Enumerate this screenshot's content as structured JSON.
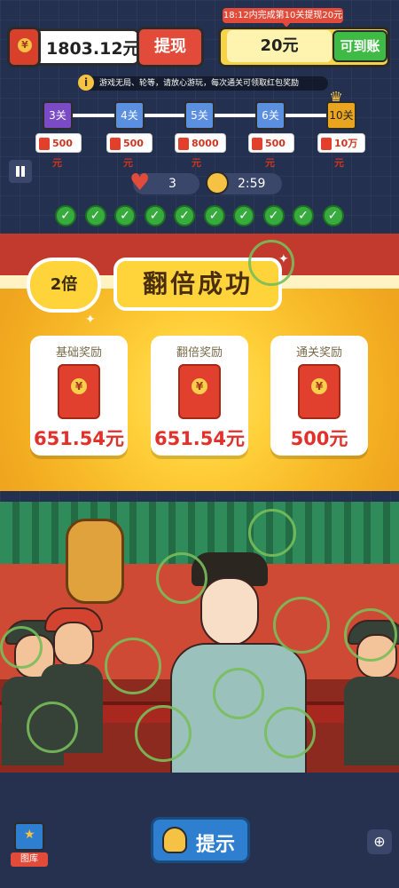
{
  "header": {
    "balance": "1803.12元",
    "withdraw_label": "提现",
    "tip_banner": "18:12内完成第10关提现20元",
    "target_amount": "20元",
    "arrive_label": "可到账",
    "info_text": "游戏无局、轮等，请放心游玩，每次通关可领取红包奖励"
  },
  "levels": [
    {
      "label": "3关",
      "reward": "500元",
      "state": "current"
    },
    {
      "label": "4关",
      "reward": "500元",
      "state": "locked"
    },
    {
      "label": "5关",
      "reward": "8000元",
      "state": "locked"
    },
    {
      "label": "6关",
      "reward": "500元",
      "state": "locked"
    },
    {
      "label": "10关",
      "reward": "10万元",
      "state": "final"
    }
  ],
  "stats": {
    "lives": "3",
    "timer": "2:59",
    "progress_total": 10,
    "progress_done": 10
  },
  "reward_popup": {
    "multiplier": "2倍",
    "title": "翻倍成功",
    "cards": [
      {
        "title": "基础奖励",
        "amount": "651.54元"
      },
      {
        "title": "翻倍奖励",
        "amount": "651.54元"
      },
      {
        "title": "通关奖励",
        "amount": "500元"
      }
    ]
  },
  "bottom": {
    "album_label": "图库",
    "hint_label": "提示",
    "zoom_icon": "zoom-in-icon"
  },
  "colors": {
    "accent_red": "#e24b3a",
    "accent_green": "#3fbb45",
    "accent_yellow": "#f6d44a",
    "reward_red": "#e2302a"
  }
}
